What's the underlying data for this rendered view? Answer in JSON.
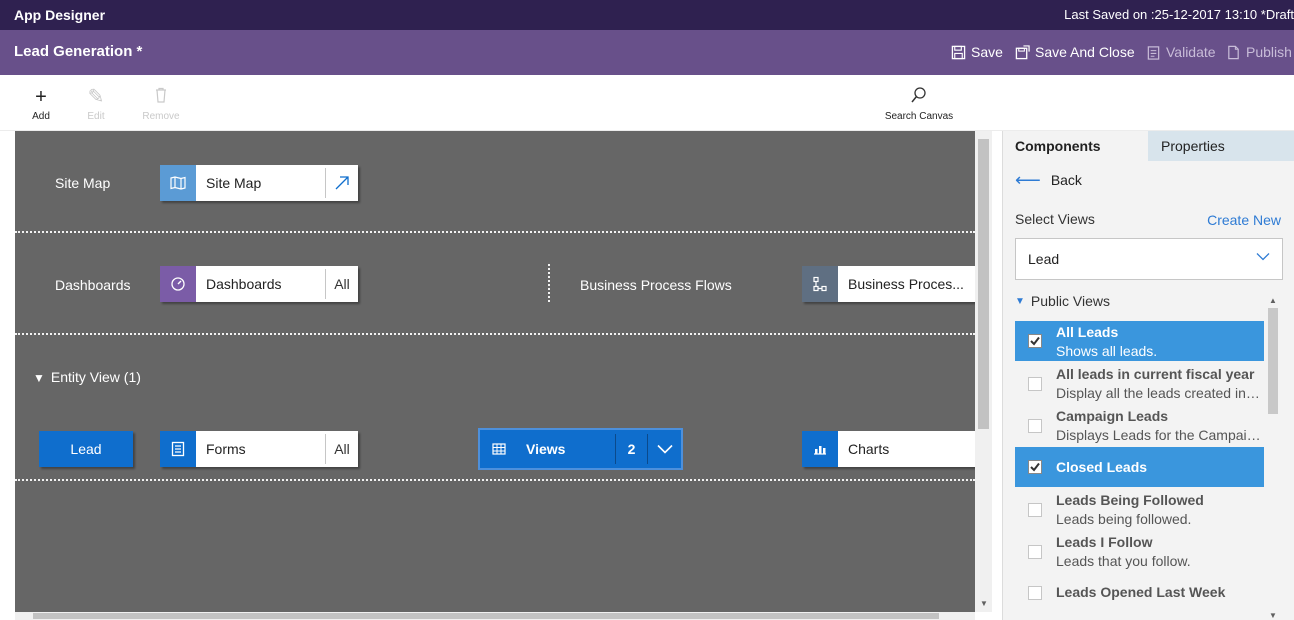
{
  "topbar": {
    "app_title": "App Designer",
    "last_saved": "Last Saved on :25-12-2017 13:10 *Draft"
  },
  "header": {
    "app_name": "Lead Generation *",
    "commands": {
      "save": "Save",
      "save_and_close": "Save And Close",
      "validate": "Validate",
      "publish": "Publish"
    }
  },
  "toolbar": {
    "add": "Add",
    "edit": "Edit",
    "remove": "Remove",
    "search_canvas": "Search Canvas"
  },
  "canvas": {
    "site_map": {
      "row_label": "Site Map",
      "tile_label": "Site Map"
    },
    "dashboards": {
      "row_label": "Dashboards",
      "tile_label": "Dashboards",
      "tile_side": "All"
    },
    "bpf": {
      "row_label": "Business Process Flows",
      "tile_label": "Business Proces..."
    },
    "entity_view": {
      "label": "Entity View (1)",
      "entity": "Lead"
    },
    "forms": {
      "label": "Forms",
      "side": "All"
    },
    "views": {
      "label": "Views",
      "count": "2"
    },
    "charts": {
      "label": "Charts"
    }
  },
  "panel": {
    "tabs": {
      "components": "Components",
      "properties": "Properties"
    },
    "back": "Back",
    "select_views": "Select Views",
    "create_new": "Create New",
    "entity_select": "Lead",
    "public_views": "Public Views",
    "views": [
      {
        "title": "All Leads",
        "desc": "Shows all leads.",
        "checked": true
      },
      {
        "title": "All leads in current fiscal year",
        "desc": "Display all the leads created in t...",
        "checked": false
      },
      {
        "title": "Campaign Leads",
        "desc": "Displays Leads for the Campaig...",
        "checked": false
      },
      {
        "title": "Closed Leads",
        "desc": "",
        "checked": true
      },
      {
        "title": "Leads Being Followed",
        "desc": "Leads being followed.",
        "checked": false
      },
      {
        "title": "Leads I Follow",
        "desc": "Leads that you follow.",
        "checked": false
      },
      {
        "title": "Leads Opened Last Week",
        "desc": "",
        "checked": false
      }
    ]
  },
  "colors": {
    "topbar": "#2f2150",
    "header": "#68508a",
    "canvas": "#666666",
    "accent": "#0f6ecd",
    "selected": "#3a96dd"
  }
}
